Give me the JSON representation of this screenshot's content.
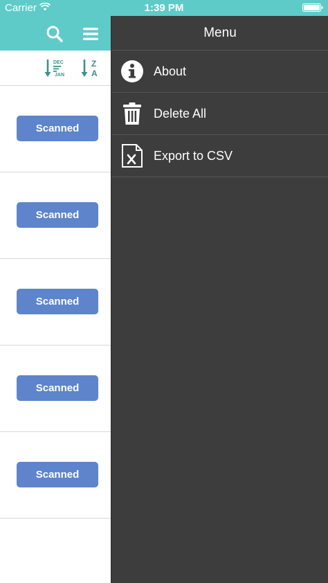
{
  "status_bar": {
    "carrier": "Carrier",
    "time": "1:39 PM"
  },
  "main": {
    "toolbar_icons": [
      "search-icon",
      "hamburger-menu-icon"
    ],
    "sort_bar": {
      "date_sort": {
        "icon": "sort-date-icon",
        "top_label": "DEC",
        "bottom_label": "JAN"
      },
      "alpha_sort": {
        "icon": "sort-alpha-icon",
        "top_label": "Z",
        "bottom_label": "A"
      }
    },
    "rows": [
      {
        "status_label": "Scanned"
      },
      {
        "status_label": "Scanned"
      },
      {
        "status_label": "Scanned"
      },
      {
        "status_label": "Scanned"
      },
      {
        "status_label": "Scanned"
      }
    ]
  },
  "drawer": {
    "title": "Menu",
    "items": [
      {
        "label": "About",
        "icon": "info-icon"
      },
      {
        "label": "Delete All",
        "icon": "trash-icon"
      },
      {
        "label": "Export to CSV",
        "icon": "excel-file-icon"
      }
    ]
  },
  "colors": {
    "accent": "#5ecbc9",
    "button": "#5e84cc",
    "drawer_background": "#3d3d3d",
    "divider": "#d8d8d8",
    "sort_icon": "#3e8f8c"
  }
}
